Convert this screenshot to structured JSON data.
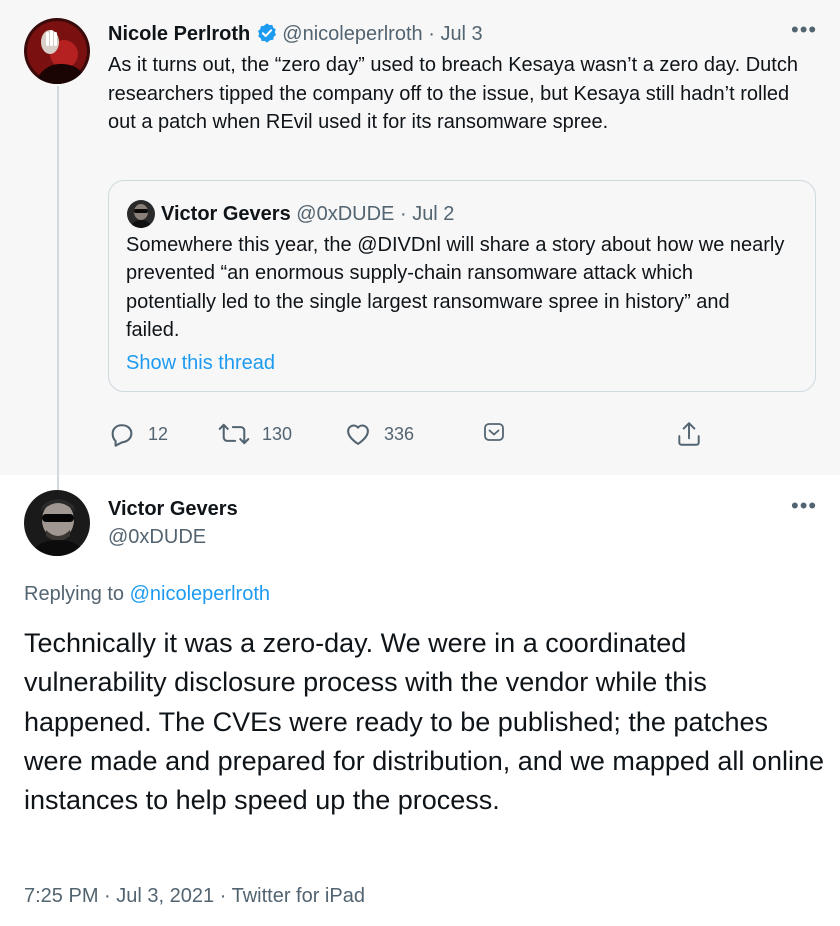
{
  "parent_tweet": {
    "author_name": "Nicole Perlroth",
    "handle": "@nicoleperlroth",
    "separator": "·",
    "date": "Jul 3",
    "text": "As it turns out, the “zero day” used to breach Kesaya wasn’t a zero day. Dutch researchers tipped the company off to the issue, but Kesaya still hadn’t rolled out a patch when REvil used it for its ransomware spree.",
    "more_label": "•••",
    "quoted_tweet": {
      "author_name": "Victor Gevers",
      "handle": "@0xDUDE",
      "separator": "·",
      "date": "Jul 2",
      "text": "Somewhere this year, the @DIVDnl will share a story about how we nearly prevented “an enormous supply-chain ransomware attack which potentially led to the single largest ransomware spree in history” and failed.",
      "show_thread_label": "Show this thread"
    },
    "actions": {
      "replies": "12",
      "retweets": "130",
      "likes": "336"
    }
  },
  "reply_tweet": {
    "author_name": "Victor Gevers",
    "handle": "@0xDUDE",
    "more_label": "•••",
    "replying_prefix": "Replying to",
    "replying_to": "@nicoleperlroth",
    "text": "Technically it was a zero-day. We were in a coordinated vulnerability disclosure process with the vendor while this happened. The CVEs were ready to be published; the patches were made and prepared for distribution, and we mapped all online instances to help speed up the process.",
    "time": "7:25 PM",
    "separator": "·",
    "date": "Jul 3, 2021",
    "separator2": "·",
    "client": "Twitter for iPad"
  },
  "colors": {
    "accent": "#1d9bf0",
    "muted": "#536471",
    "text": "#0f1419",
    "parent_bg": "#f7f7f7"
  },
  "icons": {
    "verified": "verified-badge-icon",
    "reply": "reply-icon",
    "retweet": "retweet-icon",
    "like": "heart-icon",
    "tip": "tip-jar-icon",
    "share": "share-icon",
    "more": "more-options-icon"
  }
}
